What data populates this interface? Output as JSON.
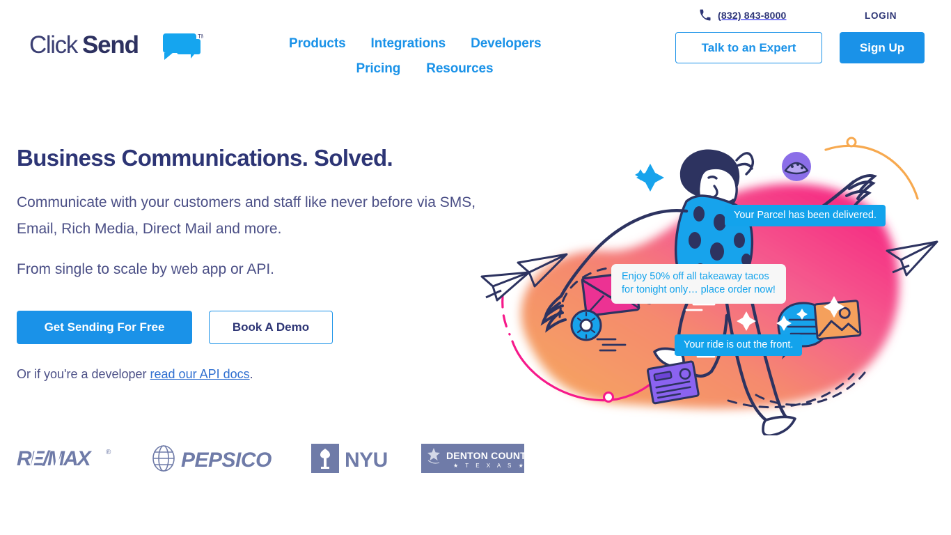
{
  "brand": {
    "name_light": "Click",
    "name_bold": "Send",
    "trademark": "TM",
    "logo_navy": "#2d3575",
    "logo_blue": "#15a5ef"
  },
  "header": {
    "nav_row1": [
      {
        "label": "Products",
        "name": "nav-products"
      },
      {
        "label": "Integrations",
        "name": "nav-integrations"
      },
      {
        "label": "Developers",
        "name": "nav-developers"
      }
    ],
    "nav_row2": [
      {
        "label": "Pricing",
        "name": "nav-pricing"
      },
      {
        "label": "Resources",
        "name": "nav-resources"
      }
    ],
    "phone": "(832) 843-8000",
    "phone_icon": "phone-icon",
    "login_label": "LOGIN",
    "expert_button": "Talk to an Expert",
    "signup_button": "Sign Up",
    "accent_blue": "#1a92e8",
    "text_navy": "#2d3575"
  },
  "hero": {
    "title": "Business Communications. Solved.",
    "paragraph1": "Communicate with your customers and staff like never before via SMS, Email, Rich Media, Direct Mail and more.",
    "paragraph2": "From single to scale by web app or API.",
    "primary_button": "Get Sending For Free",
    "secondary_button": "Book A Demo",
    "developer_prefix": "Or if you're a developer ",
    "developer_link": "read our API docs",
    "developer_suffix": "."
  },
  "illustration": {
    "bubbles": [
      {
        "name": "bubble-parcel",
        "text": "Your Parcel has been delivered.",
        "style": "blue"
      },
      {
        "name": "bubble-tacos",
        "text": "Enjoy 50% off all takeaway tacos\nfor tonight only… place order now!",
        "style": "white"
      },
      {
        "name": "bubble-ride",
        "text": "Your ride is out the front.",
        "style": "blue"
      }
    ],
    "colors": {
      "blob_orange": "#f59b55",
      "blob_pink": "#f6257f",
      "ink_navy": "#2d3360",
      "bubble_blue": "#13a3ec",
      "envelope_pink": "#ec3293",
      "taco_purple": "#8b6ee8",
      "card_purple": "#8b63f0",
      "photo_orange": "#f5a05c",
      "curve_pink": "#f6198a",
      "curve_orange": "#f7a94f"
    },
    "icons": [
      "envelope-icon",
      "taco-icon",
      "donut-icon",
      "speech-bubble-icon",
      "photo-icon",
      "id-card-icon",
      "paper-plane-icon",
      "sparkle-icon"
    ]
  },
  "clients": [
    {
      "name": "logo-remax",
      "label": "RE/MAX",
      "registered": "®"
    },
    {
      "name": "logo-pepsico",
      "label": "PEPSICO"
    },
    {
      "name": "logo-nyu",
      "label": "NYU"
    },
    {
      "name": "logo-denton",
      "label": "DENTON COUNTY",
      "sub": "TEXAS"
    }
  ],
  "client_color": "#6f7ba8"
}
